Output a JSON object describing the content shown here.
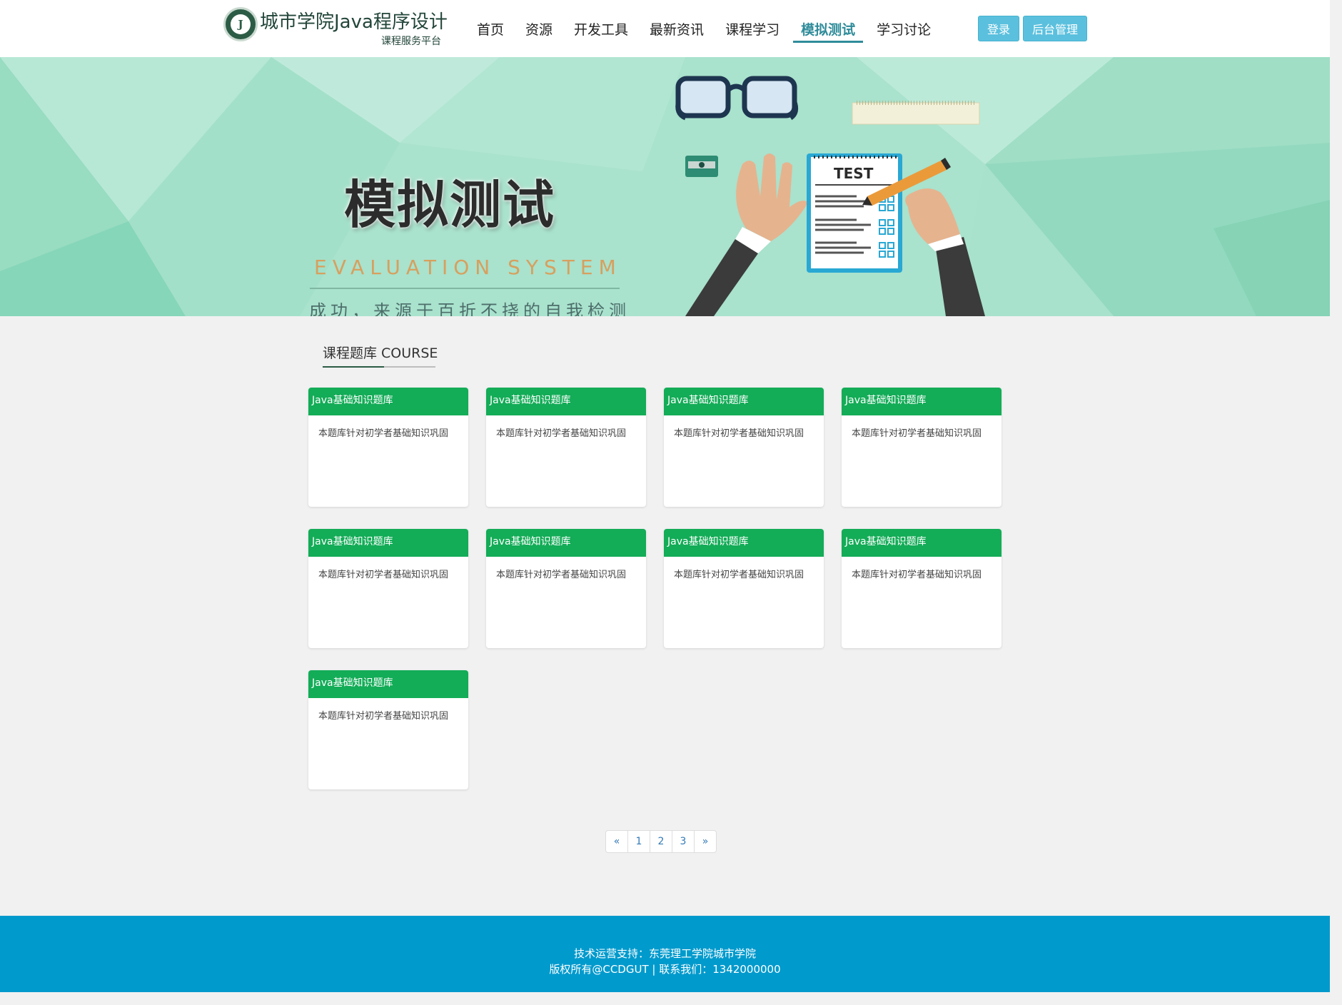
{
  "header": {
    "site_title": "城市学院Java程序设计",
    "site_subtitle": "课程服务平台",
    "nav": [
      {
        "label": "首页"
      },
      {
        "label": "资源"
      },
      {
        "label": "开发工具"
      },
      {
        "label": "最新资讯"
      },
      {
        "label": "课程学习"
      },
      {
        "label": "模拟测试",
        "active": true
      },
      {
        "label": "学习讨论"
      }
    ],
    "login_label": "登录",
    "admin_label": "后台管理",
    "accent_color": "#2f8c9a",
    "button_color": "#5bc0de"
  },
  "banner": {
    "title": "模拟测试",
    "subtitle_en": "EVALUATION  SYSTEM",
    "slogan": "成功，来源于百折不挠的自我检测",
    "illustration_text": "TEST"
  },
  "section": {
    "title": "课程题库  COURSE"
  },
  "cards": [
    {
      "title": "Java基础知识题库",
      "desc": "本题库针对初学者基础知识巩固"
    },
    {
      "title": "Java基础知识题库",
      "desc": "本题库针对初学者基础知识巩固"
    },
    {
      "title": "Java基础知识题库",
      "desc": "本题库针对初学者基础知识巩固"
    },
    {
      "title": "Java基础知识题库",
      "desc": "本题库针对初学者基础知识巩固"
    },
    {
      "title": "Java基础知识题库",
      "desc": "本题库针对初学者基础知识巩固"
    },
    {
      "title": "Java基础知识题库",
      "desc": "本题库针对初学者基础知识巩固"
    },
    {
      "title": "Java基础知识题库",
      "desc": "本题库针对初学者基础知识巩固"
    },
    {
      "title": "Java基础知识题库",
      "desc": "本题库针对初学者基础知识巩固"
    },
    {
      "title": "Java基础知识题库",
      "desc": "本题库针对初学者基础知识巩固"
    }
  ],
  "pagination": {
    "prev": "«",
    "pages": [
      "1",
      "2",
      "3"
    ],
    "next": "»"
  },
  "footer": {
    "line1": "技术运营支持：东莞理工学院城市学院",
    "line2": "版权所有@CCDGUT | 联系我们：1342000000",
    "color": "#009acd"
  }
}
